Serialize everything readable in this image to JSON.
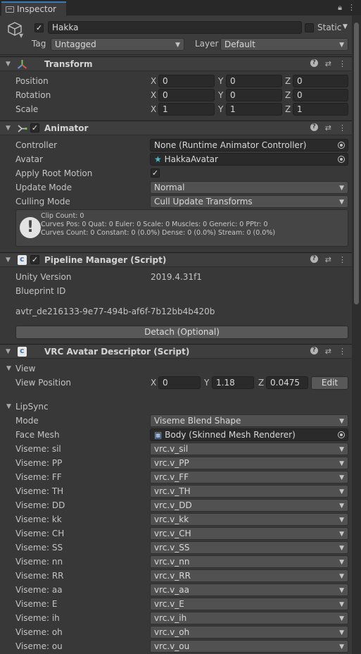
{
  "tab": {
    "title": "Inspector"
  },
  "object": {
    "name": "Hakka",
    "active_checked": "✓",
    "static_label": "Static",
    "tag_label": "Tag",
    "tag_value": "Untagged",
    "layer_label": "Layer",
    "layer_value": "Default"
  },
  "transform": {
    "title": "Transform",
    "rows": [
      {
        "label": "Position",
        "x": "0",
        "y": "0",
        "z": "0"
      },
      {
        "label": "Rotation",
        "x": "0",
        "y": "0",
        "z": "0"
      },
      {
        "label": "Scale",
        "x": "1",
        "y": "1",
        "z": "1"
      }
    ]
  },
  "axis": {
    "x": "X",
    "y": "Y",
    "z": "Z"
  },
  "animator": {
    "title": "Animator",
    "enabled": "✓",
    "controller_label": "Controller",
    "controller_value": "None (Runtime Animator Controller)",
    "avatar_label": "Avatar",
    "avatar_value": "HakkaAvatar",
    "root_motion_label": "Apply Root Motion",
    "root_motion_value": "✓",
    "update_mode_label": "Update Mode",
    "update_mode_value": "Normal",
    "culling_mode_label": "Culling Mode",
    "culling_mode_value": "Cull Update Transforms",
    "info_lines": [
      "Clip Count: 0",
      "Curves Pos: 0 Quat: 0 Euler: 0 Scale: 0 Muscles: 0 Generic: 0 PPtr: 0",
      "Curves Count: 0 Constant: 0 (0.0%) Dense: 0 (0.0%) Stream: 0 (0.0%)"
    ]
  },
  "pipeline": {
    "title": "Pipeline Manager (Script)",
    "enabled": "✓",
    "unity_version_label": "Unity Version",
    "unity_version_value": "2019.4.31f1",
    "blueprint_label": "Blueprint ID",
    "blueprint_value": "avtr_de216133-9e77-494b-af6f-7b12bb4b420b",
    "detach_button": "Detach (Optional)"
  },
  "descriptor": {
    "title": "VRC Avatar Descriptor (Script)",
    "view_section": "View",
    "view_position_label": "View Position",
    "view_x": "0",
    "view_y": "1.18",
    "view_z": "0.0475",
    "edit_button": "Edit",
    "lipsync_section": "LipSync",
    "mode_label": "Mode",
    "mode_value": "Viseme Blend Shape",
    "face_mesh_label": "Face Mesh",
    "face_mesh_value": "Body (Skinned Mesh Renderer)",
    "visemes": [
      {
        "label": "Viseme: sil",
        "value": "vrc.v_sil"
      },
      {
        "label": "Viseme: PP",
        "value": "vrc.v_PP"
      },
      {
        "label": "Viseme: FF",
        "value": "vrc.v_FF"
      },
      {
        "label": "Viseme: TH",
        "value": "vrc.v_TH"
      },
      {
        "label": "Viseme: DD",
        "value": "vrc.v_DD"
      },
      {
        "label": "Viseme: kk",
        "value": "vrc.v_kk"
      },
      {
        "label": "Viseme: CH",
        "value": "vrc.v_CH"
      },
      {
        "label": "Viseme: SS",
        "value": "vrc.v_SS"
      },
      {
        "label": "Viseme: nn",
        "value": "vrc.v_nn"
      },
      {
        "label": "Viseme: RR",
        "value": "vrc.v_RR"
      },
      {
        "label": "Viseme: aa",
        "value": "vrc.v_aa"
      },
      {
        "label": "Viseme: E",
        "value": "vrc.v_E"
      },
      {
        "label": "Viseme: ih",
        "value": "vrc.v_ih"
      },
      {
        "label": "Viseme: oh",
        "value": "vrc.v_oh"
      },
      {
        "label": "Viseme: ou",
        "value": "vrc.v_ou"
      }
    ]
  }
}
